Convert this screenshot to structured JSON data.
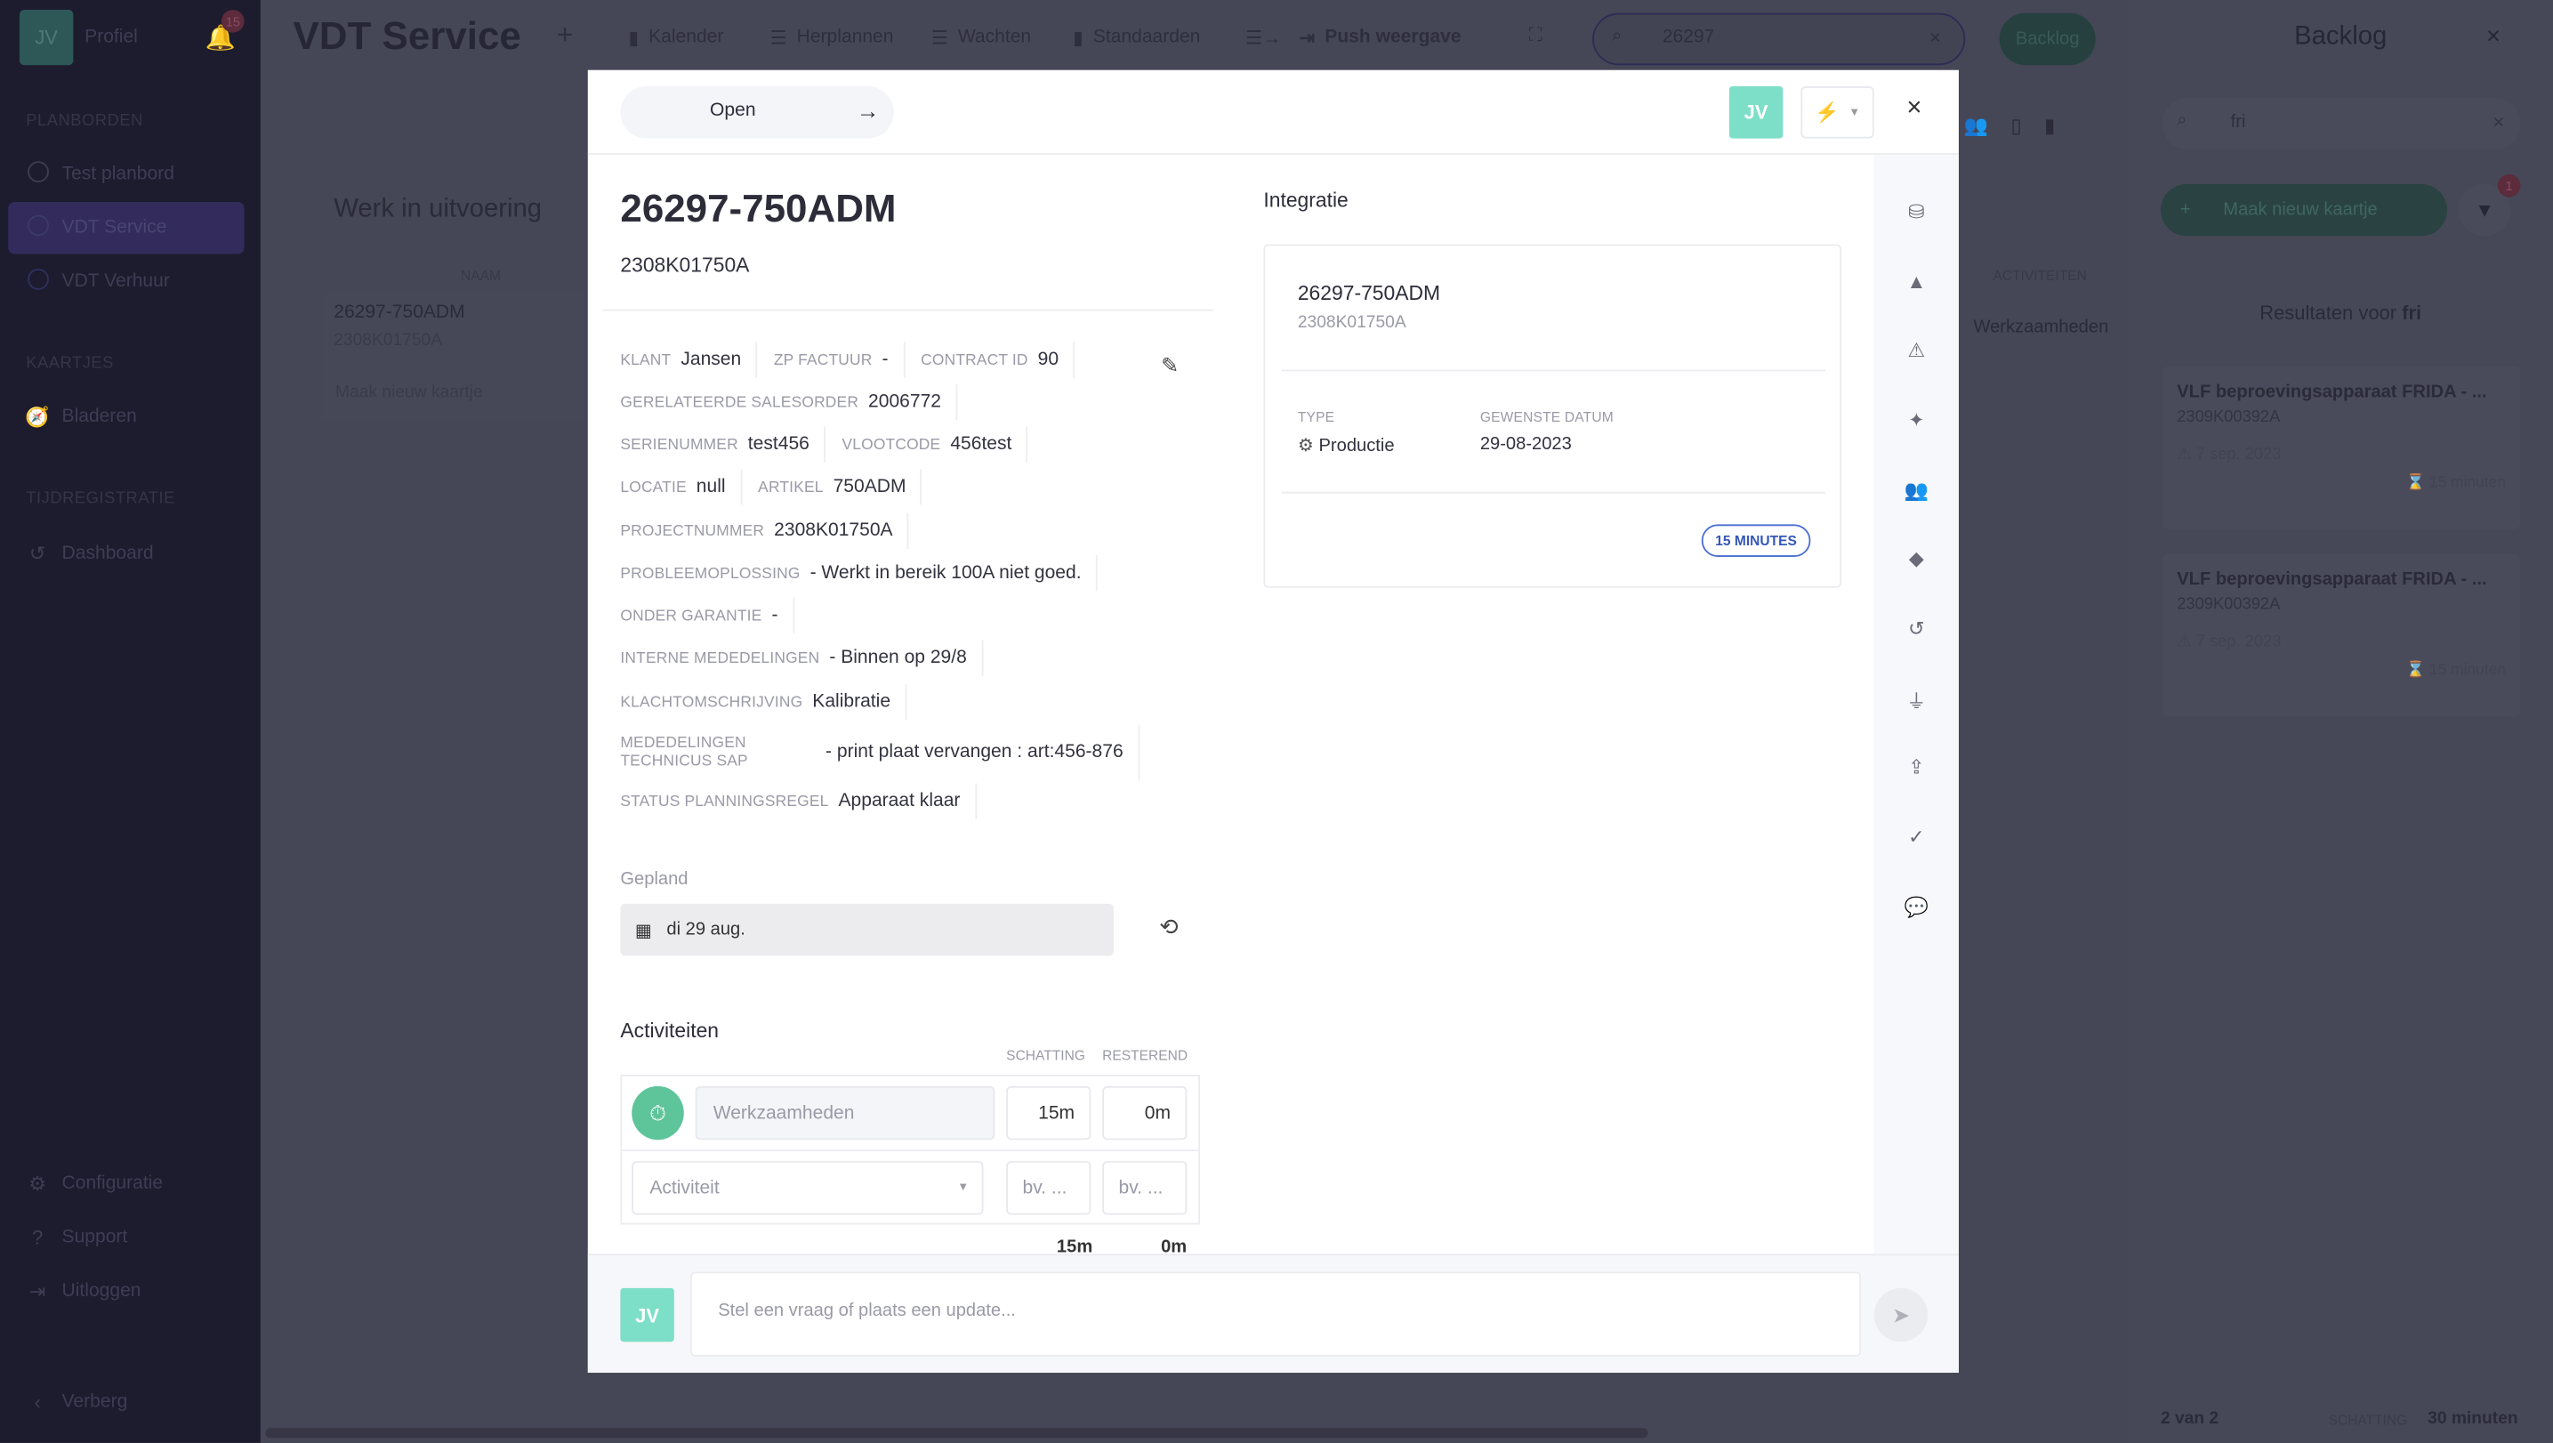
{
  "sidebar": {
    "avatar": "JV",
    "profile": "Profiel",
    "notif_count": "15",
    "sections": {
      "planborden": "PLANBORDEN",
      "kaartjes": "KAARTJES",
      "tijd": "TIJDREGISTRATIE"
    },
    "boards": [
      {
        "label": "Test planbord"
      },
      {
        "label": "VDT Service",
        "active": true
      },
      {
        "label": "VDT Verhuur"
      }
    ],
    "browse": "Bladeren",
    "dashboard": "Dashboard",
    "config": "Configuratie",
    "support": "Support",
    "logout": "Uitloggen",
    "hide": "Verberg"
  },
  "topbar": {
    "title": "VDT Service",
    "add": "+",
    "nav": [
      "Kalender",
      "Herplannen",
      "Wachten",
      "Standaarden"
    ],
    "push": "Push weergave",
    "search_value": "26297",
    "backlog_button": "Backlog"
  },
  "board": {
    "column_title": "Werk in uitvoering",
    "col_name": "NAAM",
    "col_activities": "ACTIVITEITEN",
    "card_title": "26297-750ADM",
    "card_sub": "2308K01750A",
    "new_card": "Maak nieuw kaartje",
    "activity": "Werkzaamheden"
  },
  "backlog": {
    "title": "Backlog",
    "search_value": "fri",
    "new_card": "Maak nieuw kaartje",
    "filter_badge": "1",
    "results_prefix": "Resultaten voor ",
    "results_query": "fri",
    "cards": [
      {
        "title": "VLF beproevingsapparaat FRIDA - ...",
        "sub": "2309K00392A",
        "date": "7 sep. 2023",
        "duration": "15 minuten"
      },
      {
        "title": "VLF beproevingsapparaat FRIDA - ...",
        "sub": "2309K00392A",
        "date": "7 sep. 2023",
        "duration": "15 minuten"
      }
    ],
    "count": "2 van 2",
    "estimate_label": "SCHATTING",
    "estimate": "30 minuten"
  },
  "modal": {
    "status_button": "Open",
    "avatar": "JV",
    "title": "26297-750ADM",
    "subtitle": "2308K01750A",
    "fields": [
      [
        {
          "label": "KLANT",
          "value": "Jansen"
        },
        {
          "label": "ZP FACTUUR",
          "value": "-"
        },
        {
          "label": "CONTRACT ID",
          "value": "90"
        }
      ],
      [
        {
          "label": "GERELATEERDE SALESORDER",
          "value": "2006772"
        }
      ],
      [
        {
          "label": "SERIENUMMER",
          "value": "test456"
        },
        {
          "label": "VLOOTCODE",
          "value": "456test"
        }
      ],
      [
        {
          "label": "LOCATIE",
          "value": "null"
        },
        {
          "label": "ARTIKEL",
          "value": "750ADM"
        }
      ],
      [
        {
          "label": "PROJECTNUMMER",
          "value": "2308K01750A"
        }
      ],
      [
        {
          "label": "PROBLEEMOPLOSSING",
          "value": "- Werkt in bereik 100A niet goed."
        }
      ],
      [
        {
          "label": "ONDER GARANTIE",
          "value": "-"
        }
      ],
      [
        {
          "label": "INTERNE MEDEDELINGEN",
          "value": "- Binnen op 29/8"
        }
      ],
      [
        {
          "label": "KLACHTOMSCHRIJVING",
          "value": "Kalibratie"
        }
      ],
      [
        {
          "label": "MEDEDELINGEN TECHNICUS SAP",
          "value": "- print plaat vervangen : art:456-876"
        }
      ],
      [
        {
          "label": "STATUS PLANNINGSREGEL",
          "value": "Apparaat klaar"
        }
      ]
    ],
    "planned_label": "Gepland",
    "planned_date": "di 29 aug.",
    "activities": {
      "title": "Activiteiten",
      "col_estimate": "SCHATTING",
      "col_remaining": "RESTEREND",
      "rows": [
        {
          "name": "Werkzaamheden",
          "estimate": "15m",
          "remaining": "0m"
        }
      ],
      "new_placeholder": "Activiteit",
      "estimate_placeholder": "bv. ...",
      "remaining_placeholder": "bv. ...",
      "total_estimate": "15m",
      "total_remaining": "0m"
    },
    "integration": {
      "title": "Integratie",
      "card_title": "26297-750ADM",
      "card_sub": "2308K01750A",
      "type_label": "TYPE",
      "type_value": "Productie",
      "date_label": "GEWENSTE DATUM",
      "date_value": "29-08-2023",
      "badge": "15 MINUTES"
    },
    "comment_placeholder": "Stel een vraag of plaats een update...",
    "rail_icons": [
      "integration-icon",
      "shapes-icon",
      "alarm-icon",
      "magic-wand-icon",
      "users-icon",
      "tag-icon",
      "history-icon",
      "plug-icon",
      "upload-icon",
      "check-icon",
      "chat-question-icon"
    ]
  },
  "colors": {
    "accent": "#7ddfc8",
    "green": "#5ec49a",
    "badge_blue": "#4a6fd1",
    "sidebar": "#1d1c2e"
  }
}
